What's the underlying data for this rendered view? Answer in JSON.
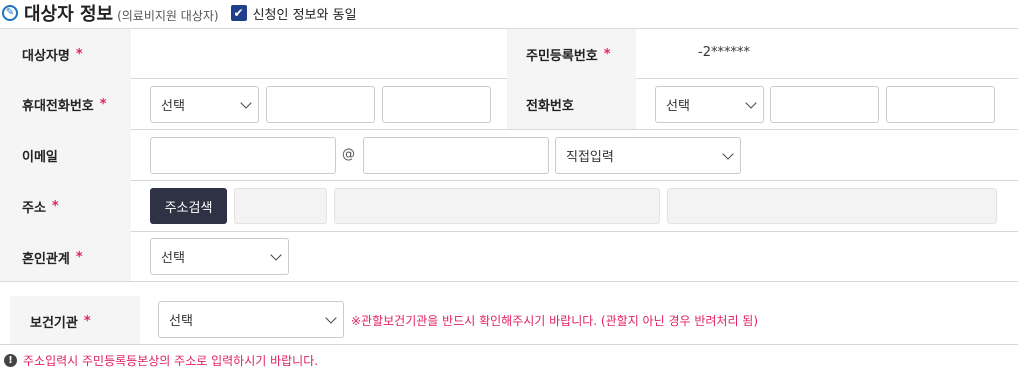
{
  "header": {
    "title": "대상자 정보",
    "subtitle": "(의료비지원 대상자)",
    "same_as_applicant_label": "신청인 정보와 동일",
    "same_as_applicant_checked": true
  },
  "rows": {
    "name": {
      "label": "대상자명",
      "value": ""
    },
    "resident_number": {
      "label": "주민등록번호",
      "value": "-2******"
    },
    "mobile": {
      "label": "휴대전화번호",
      "prefix_select": "선택",
      "middle": "",
      "last": ""
    },
    "phone": {
      "label": "전화번호",
      "prefix_select": "선택",
      "middle": "",
      "last": ""
    },
    "email": {
      "label": "이메일",
      "local": "",
      "at": "@",
      "domain": "",
      "domain_select": "직접입력"
    },
    "address": {
      "label": "주소",
      "search_button": "주소검색",
      "zip": "",
      "addr1": "",
      "addr2": ""
    },
    "marriage": {
      "label": "혼인관계",
      "select": "선택"
    },
    "health_center": {
      "label": "보건기관",
      "select": "선택",
      "notice": "※관할보건기관을 반드시 확인해주시기 바랍니다. (관할지 아닌 경우 반려처리 됨)"
    }
  },
  "required_mark": "*",
  "footer_notice": "주소입력시 주민등록등본상의 주소로 입력하시기 바랍니다.",
  "icons": {
    "title": "circled-edit-icon",
    "checkbox": "checkbox-checked-icon",
    "footer": "info-circle-icon"
  },
  "colors": {
    "accent": "#1e73be",
    "required": "#e0245e",
    "checkbox": "#1f3e8c",
    "button": "#2f3245"
  }
}
